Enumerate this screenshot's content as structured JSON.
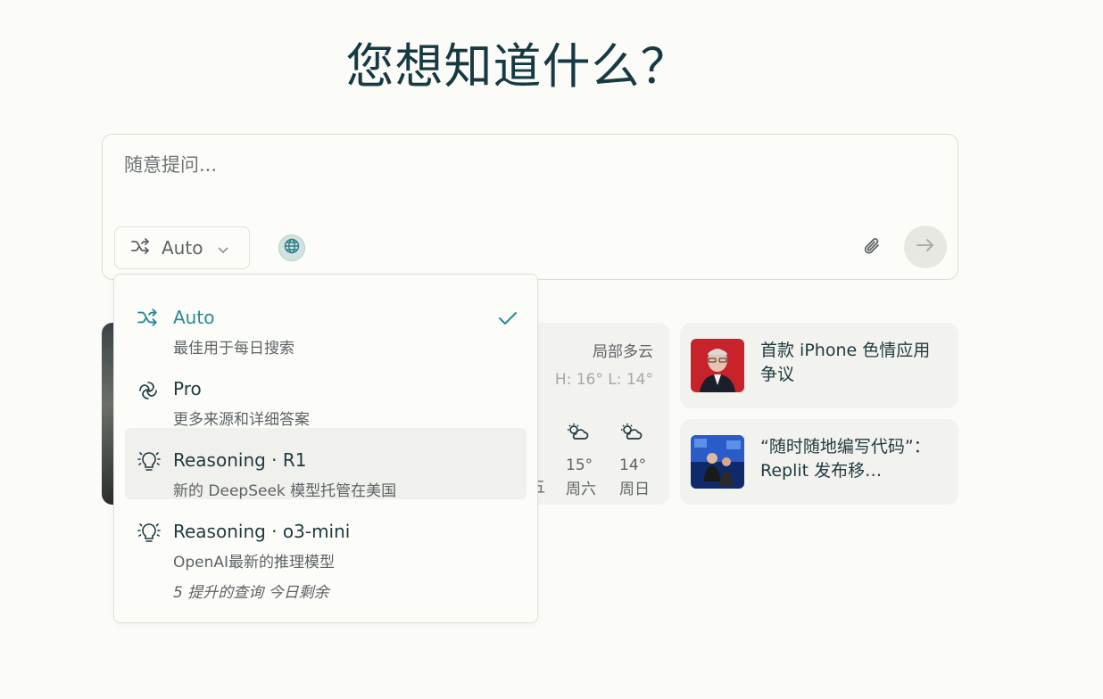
{
  "hero": {
    "title": "您想知道什么？"
  },
  "composer": {
    "placeholder": "随意提问...",
    "mode_label": "Auto"
  },
  "dropdown": {
    "options": [
      {
        "label": "Auto",
        "desc": "最佳用于每日搜索",
        "icon": "shuffle-icon",
        "selected": true
      },
      {
        "label": "Pro",
        "desc": "更多来源和详细答案",
        "icon": "pro-icon",
        "selected": false
      },
      {
        "label": "Reasoning · R1",
        "desc": "新的 DeepSeek 模型托管在美国",
        "icon": "lightbulb-icon",
        "selected": false
      },
      {
        "label": "Reasoning · o3-mini",
        "desc": "OpenAI最新的推理模型",
        "icon": "lightbulb-icon",
        "selected": false
      }
    ],
    "footnote": "5 提升的查询 今日剩余"
  },
  "weather": {
    "condition": "局部多云",
    "high_low": "H: 16° L: 14°",
    "forecast": [
      {
        "temp": "15°",
        "day": "周六",
        "icon": "partly-cloudy-icon"
      },
      {
        "temp": "14°",
        "day": "周日",
        "icon": "partly-cloudy-icon"
      }
    ],
    "partial_day": "五"
  },
  "news": [
    {
      "title": "首款 iPhone 色情应用争议"
    },
    {
      "title": "“随时随地编写代码”：Replit 发布移…"
    }
  ],
  "colors": {
    "accent": "#2a8a92",
    "text": "#1f3a40",
    "muted": "#5d6466",
    "background": "#fbfbf7"
  }
}
